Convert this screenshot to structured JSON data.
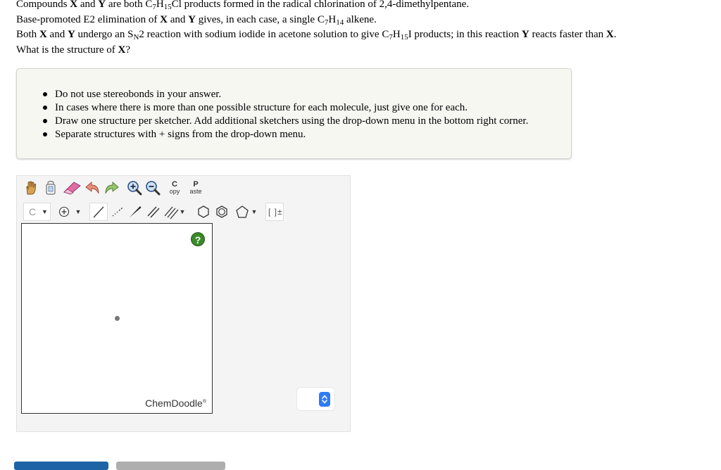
{
  "question": {
    "l1_a": "Compounds ",
    "l1_x": "X",
    "l1_and": " and ",
    "l1_y": "Y",
    "l1_b": " are both C",
    "l1_s1": "7",
    "l1_h": "H",
    "l1_s2": "15",
    "l1_c": "Cl products formed in the radical chlorination of 2,4-dimethylpentane.",
    "l2_a": "Base-promoted E2 elimination of ",
    "l2_x": "X",
    "l2_and": " and ",
    "l2_y": "Y",
    "l2_b": " gives, in each case, a single C",
    "l2_s1": "7",
    "l2_h": "H",
    "l2_s2": "14",
    "l2_c": " alkene.",
    "l3_a": "Both ",
    "l3_x": "X",
    "l3_and": " and ",
    "l3_y": "Y",
    "l3_b": " undergo an S",
    "l3_sn": "N",
    "l3_c": "2 reaction with sodium iodide in acetone solution to give C",
    "l3_s1": "7",
    "l3_h": "H",
    "l3_s2": "15",
    "l3_d": "I products; in this reaction ",
    "l3_y2": "Y",
    "l3_e": " reacts faster than ",
    "l3_x2": "X",
    "l3_f": ".",
    "l4_a": "What is the structure of ",
    "l4_x": "X",
    "l4_b": "?"
  },
  "instructions": [
    "Do not use stereobonds in your answer.",
    "In cases where there is more than one possible structure for each molecule, just give one for each.",
    "Draw one structure per sketcher. Add additional sketchers using the drop-down menu in the bottom right corner.",
    "Separate structures with + signs from the drop-down menu."
  ],
  "toolbar": {
    "copy_top": "C",
    "copy_bottom": "opy",
    "paste_top": "P",
    "paste_bottom": "aste",
    "atom_label": "C",
    "bracket_label": "[ ]±"
  },
  "canvas": {
    "watermark": "ChemDoodle",
    "reg": "®",
    "help": "?"
  },
  "colors": {
    "accent": "#2e7bf6",
    "help": "#3b8a2a",
    "primary_button": "#1d63a6"
  }
}
